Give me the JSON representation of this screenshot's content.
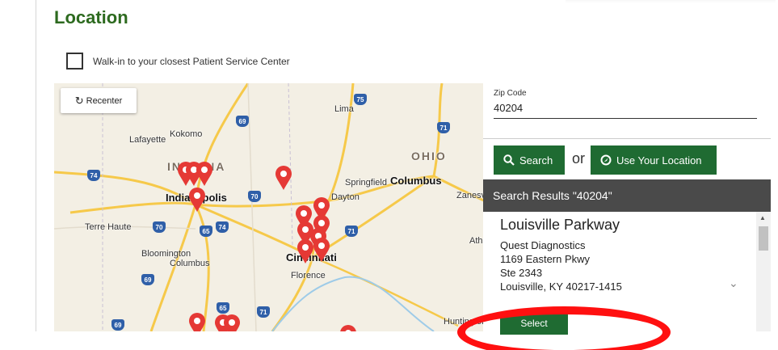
{
  "page": {
    "title": "Location",
    "walkin_label": "Walk-in to your closest Patient Service Center"
  },
  "map": {
    "recenter_label": "Recenter",
    "cities": [
      "Lima",
      "Kokomo",
      "Lafayette",
      "INDIANA",
      "OHIO",
      "Springfield",
      "Columbus",
      "Indianapolis",
      "Dayton",
      "Terre Haute",
      "Bloomington",
      "Columbus",
      "Cincinnati",
      "Florence",
      "Zanesville",
      "Athens",
      "Huntington"
    ],
    "routes": [
      "75",
      "69",
      "71",
      "74",
      "70",
      "70",
      "65",
      "74",
      "71",
      "69",
      "65",
      "71",
      "69"
    ]
  },
  "panel": {
    "zip_label": "Zip Code",
    "zip_value": "40204",
    "search_label": "Search",
    "or_text": "or",
    "location_label": "Use Your Location",
    "results_header": "Search Results \"40204\""
  },
  "result": {
    "name": "Louisville Parkway",
    "company": "Quest Diagnostics",
    "address1": "1169 Eastern Pkwy",
    "address2": "Ste 2343",
    "city_line": "Louisville, KY 40217-1415",
    "select_label": "Select"
  },
  "colors": {
    "brand_green": "#1f6b32",
    "title_green": "#2d6a1f",
    "header_gray": "#4a4a4a",
    "pin_red": "#e53935",
    "annotation_red": "#ff1010"
  }
}
